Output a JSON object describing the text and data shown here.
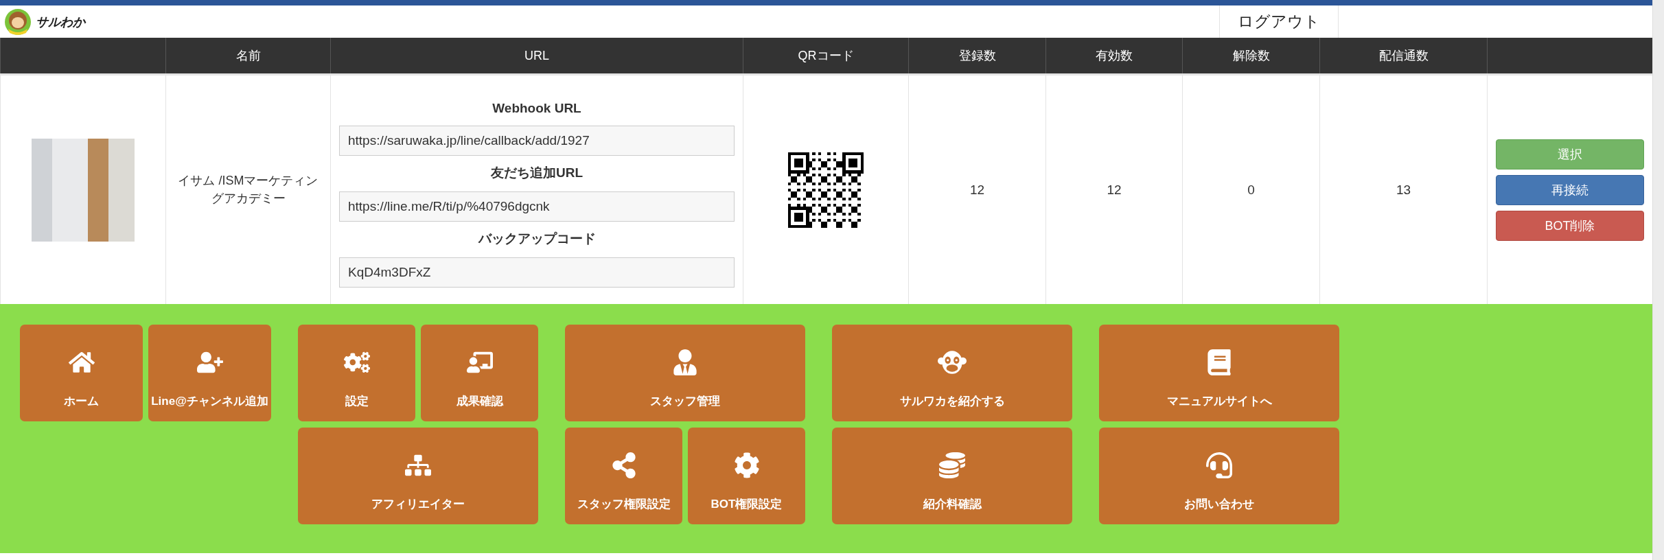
{
  "logo": {
    "text": "サルわか"
  },
  "logout": "ログアウト",
  "table": {
    "columns": [
      "名前",
      "URL",
      "QRコード",
      "登録数",
      "有効数",
      "解除数",
      "配信通数"
    ],
    "rows": [
      {
        "name": "イサム /ISMマーケティングアカデミー",
        "urls": [
          {
            "label": "Webhook URL",
            "value": "https://saruwaka.jp/line/callback/add/1927"
          },
          {
            "label": "友だち追加URL",
            "value": "https://line.me/R/ti/p/%40796dgcnk"
          },
          {
            "label": "バックアップコード",
            "value": "KqD4m3DFxZ"
          }
        ],
        "counts": [
          "12",
          "12",
          "0",
          "13"
        ],
        "actions": [
          {
            "label": "選択",
            "kind": "select"
          },
          {
            "label": "再接続",
            "kind": "reconnect"
          },
          {
            "label": "BOT削除",
            "kind": "delete"
          }
        ]
      }
    ]
  },
  "menu": {
    "groups": [
      {
        "rows": [
          [
            {
              "label": "ホーム",
              "kind": "home"
            },
            {
              "label": "Line@チャンネル追加",
              "kind": "user-plus"
            }
          ]
        ]
      },
      {
        "rows": [
          [
            {
              "label": "設定",
              "kind": "gears"
            },
            {
              "label": "成果確認",
              "kind": "presentation"
            }
          ],
          [
            {
              "label": "アフィリエイター",
              "kind": "network"
            }
          ]
        ]
      },
      {
        "rows": [
          [
            {
              "label": "スタッフ管理",
              "kind": "staff"
            }
          ],
          [
            {
              "label": "スタッフ権限設定",
              "kind": "share"
            },
            {
              "label": "BOT権限設定",
              "kind": "gear"
            }
          ]
        ]
      },
      {
        "rows": [
          [
            {
              "label": "サルワカを紹介する",
              "kind": "monkey"
            }
          ],
          [
            {
              "label": "紹介料確認",
              "kind": "coins"
            }
          ]
        ]
      },
      {
        "rows": [
          [
            {
              "label": "マニュアルサイトへ",
              "kind": "book"
            }
          ],
          [
            {
              "label": "お問い合わせ",
              "kind": "headset"
            }
          ]
        ]
      }
    ]
  }
}
